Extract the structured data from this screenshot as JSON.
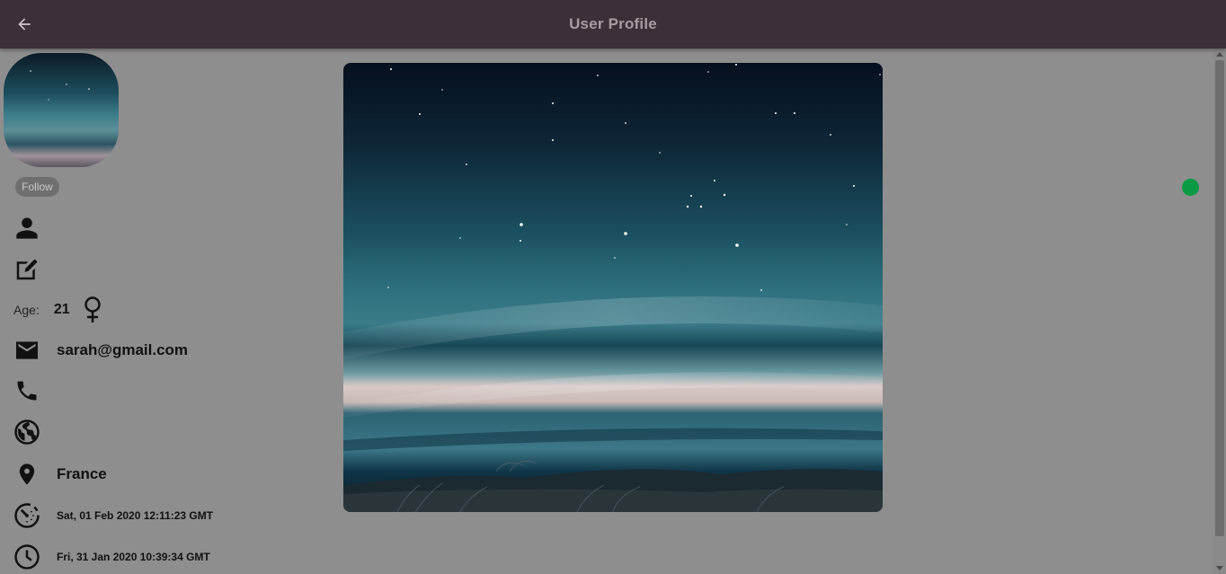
{
  "appbar": {
    "title": "User Profile",
    "back_icon": "arrow-left-icon",
    "background": "#3c2f39"
  },
  "profile": {
    "follow_label": "Follow",
    "age_label": "Age:",
    "age_value": "21",
    "gender_icon": "female-icon",
    "email": "sarah@gmail.com",
    "location": "France",
    "created_at": "Sat, 01 Feb 2020 12:11:23 GMT",
    "last_seen": "Fri, 31 Jan 2020 10:39:34 GMT",
    "online_status_color": "#0a9a44"
  },
  "icons": {
    "name": "person-icon",
    "bio": "edit-icon",
    "email": "mail-icon",
    "phone": "phone-icon",
    "website": "globe-icon",
    "location": "location-pin-icon",
    "created": "timer-icon",
    "last_seen": "clock-icon"
  }
}
